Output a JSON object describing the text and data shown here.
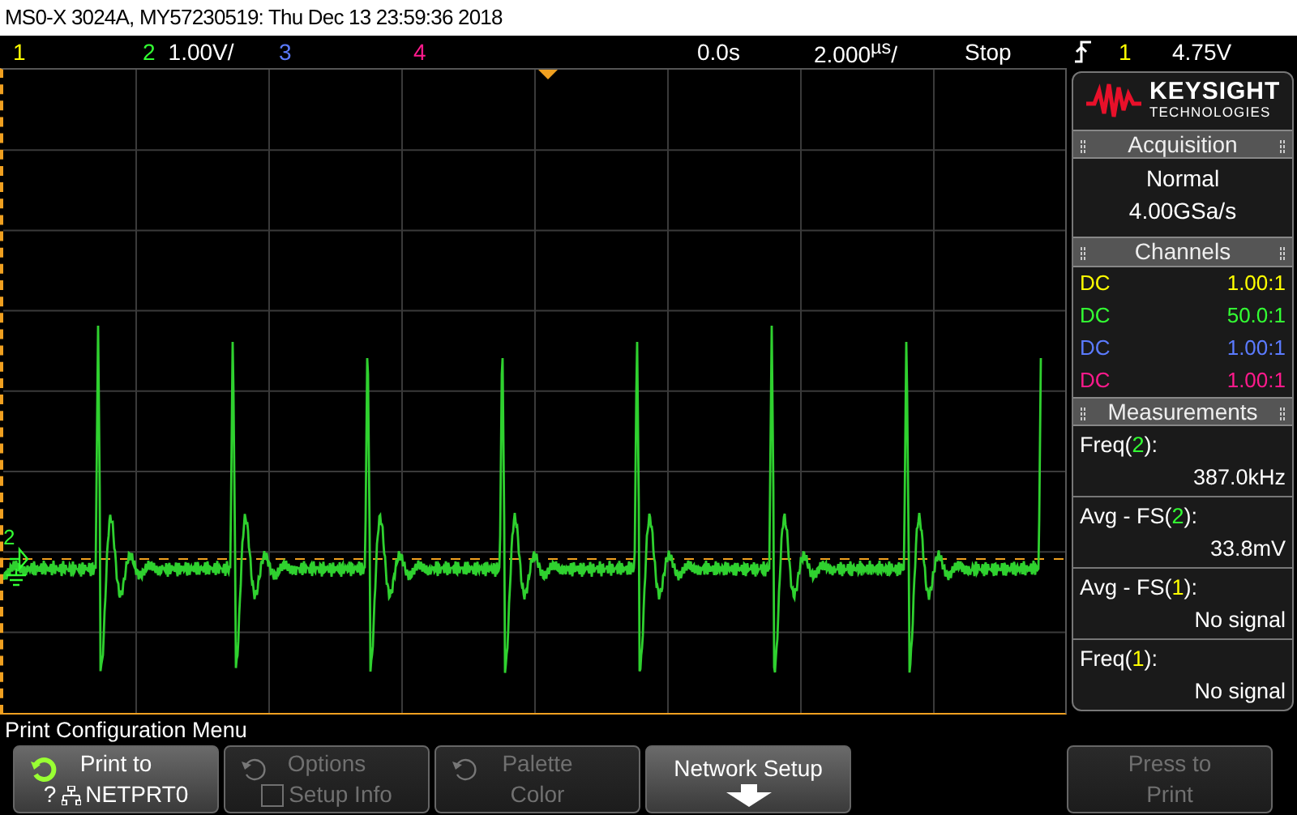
{
  "title": "MS0-X 3024A, MY57230519: Thu Dec 13 23:59:36 2018",
  "top_bar": {
    "channels": [
      {
        "label": "1",
        "color": "#ffff00"
      },
      {
        "label": "2",
        "color": "#33ff33",
        "scale": "1.00V/"
      },
      {
        "label": "3",
        "color": "#5b7bff"
      },
      {
        "label": "4",
        "color": "#ff1a8c"
      }
    ],
    "delay": "0.0s",
    "timebase": "2.000$^{µs}$/",
    "run_state": "Stop",
    "trigger": {
      "rising": true,
      "source": {
        "label": "1",
        "color": "#ffff00"
      },
      "voltage": "4.75V"
    }
  },
  "display": {
    "ground_marker": {
      "label": "2",
      "color": "#33ff33"
    }
  },
  "panel": {
    "logo": {
      "brand": "KEYSIGHT",
      "subtitle": "TECHNOLOGIES"
    },
    "acquisition": {
      "title": "Acquisition",
      "mode": "Normal",
      "rate": "4.00GSa/s"
    },
    "channels": {
      "title": "Channels",
      "rows": [
        {
          "coupling": "DC",
          "probe": "1.00:1",
          "color": "#ffff00"
        },
        {
          "coupling": "DC",
          "probe": "50.0:1",
          "color": "#33ff33"
        },
        {
          "coupling": "DC",
          "probe": "1.00:1",
          "color": "#5b7bff"
        },
        {
          "coupling": "DC",
          "probe": "1.00:1",
          "color": "#ff1a8c"
        }
      ]
    },
    "measurements": {
      "title": "Measurements",
      "items": [
        {
          "label_start": "Freq(",
          "source": {
            "label": "2",
            "color": "#33ff33"
          },
          "label_end": "):",
          "value": "387.0kHz"
        },
        {
          "label_start": "Avg - FS(",
          "source": {
            "label": "2",
            "color": "#33ff33"
          },
          "label_end": "):",
          "value": "33.8mV"
        },
        {
          "label_start": "Avg - FS(",
          "source": {
            "label": "1",
            "color": "#ffff00"
          },
          "label_end": "):",
          "value": "No signal"
        },
        {
          "label_start": "Freq(",
          "source": {
            "label": "1",
            "color": "#ffff00"
          },
          "label_end": "):",
          "value": "No signal"
        }
      ]
    }
  },
  "menu_title": "Print Configuration Menu",
  "softkeys": [
    {
      "kind": "rotate",
      "line1": "Print to",
      "line2_prefix": "?",
      "line2": "NETPRT0",
      "disabled": false
    },
    {
      "kind": "checkbox",
      "line1": "Options",
      "line2": "Setup Info",
      "checked": false,
      "disabled": true
    },
    {
      "kind": "rotate",
      "line1": "Palette",
      "line2": "Color",
      "disabled": true
    },
    {
      "kind": "submenu",
      "line1": "Network Setup",
      "disabled": false
    },
    {
      "kind": "plain",
      "line1": "Press to",
      "line2": "Print",
      "disabled": true
    }
  ]
}
